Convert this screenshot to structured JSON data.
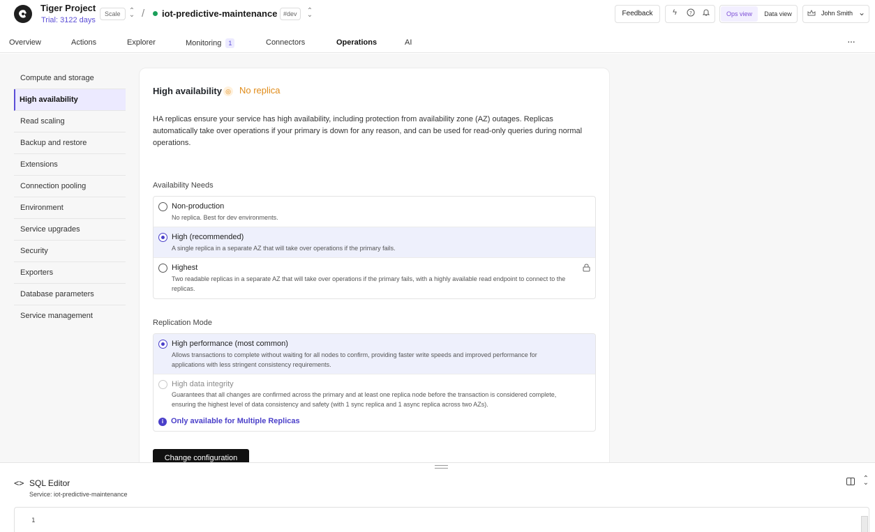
{
  "header": {
    "project_name": "Tiger Project",
    "trial_text": "Trial: 3122 days",
    "plan_badge": "Scale",
    "separator": "/",
    "service_name": "iot-predictive-maintenance",
    "env_badge": "#dev",
    "feedback_label": "Feedback",
    "ops_view_label": "Ops view",
    "data_view_label": "Data view",
    "user_name": "John Smith"
  },
  "nav": {
    "tabs": [
      {
        "label": "Overview"
      },
      {
        "label": "Actions"
      },
      {
        "label": "Explorer"
      },
      {
        "label": "Monitoring",
        "badge": "1"
      },
      {
        "label": "Connectors"
      },
      {
        "label": "Operations",
        "active": true
      },
      {
        "label": "AI"
      }
    ]
  },
  "sidebar": {
    "items": [
      {
        "label": "Compute and storage"
      },
      {
        "label": "High availability",
        "active": true
      },
      {
        "label": "Read scaling"
      },
      {
        "label": "Backup and restore"
      },
      {
        "label": "Extensions"
      },
      {
        "label": "Connection pooling"
      },
      {
        "label": "Environment"
      },
      {
        "label": "Service upgrades"
      },
      {
        "label": "Security"
      },
      {
        "label": "Exporters"
      },
      {
        "label": "Database parameters"
      },
      {
        "label": "Service management"
      }
    ]
  },
  "ha": {
    "title": "High availability",
    "status": "No replica",
    "description": "HA replicas ensure your service has high availability, including protection from availability zone (AZ) outages. Replicas automatically take over operations if your primary is down for any reason, and can be used for read-only queries during normal operations.",
    "availability_label": "Availability Needs",
    "availability_options": [
      {
        "title": "Non-production",
        "subtitle": "No replica. Best for dev environments.",
        "selected": false
      },
      {
        "title": "High (recommended)",
        "subtitle": "A single replica in a separate AZ that will take over operations if the primary fails.",
        "selected": true
      },
      {
        "title": "Highest",
        "subtitle": "Two readable replicas in a separate AZ that will take over operations if the primary fails, with a highly available read endpoint to connect to the replicas.",
        "selected": false,
        "locked": true
      }
    ],
    "replication_label": "Replication Mode",
    "replication_options": [
      {
        "title": "High performance (most common)",
        "subtitle": "Allows transactions to complete without waiting for all nodes to confirm, providing faster write speeds and improved performance for applications with less stringent consistency requirements.",
        "selected": true
      },
      {
        "title": "High data integrity",
        "subtitle": "Guarantees that all changes are confirmed across the primary and at least one replica node before the transaction is considered complete, ensuring the highest level of data consistency and safety (with 1 sync replica and 1 async replica across two AZs).",
        "selected": false,
        "disabled": true
      }
    ],
    "info_note": "Only available for Multiple Replicas",
    "button_label": "Change configuration"
  },
  "sql_editor": {
    "title": "SQL Editor",
    "service_line": "Service: iot-predictive-maintenance",
    "line_number": "1"
  },
  "colors": {
    "accent": "#5b4ed6",
    "warning": "#e08b18",
    "status_green": "#1a9f5a"
  }
}
